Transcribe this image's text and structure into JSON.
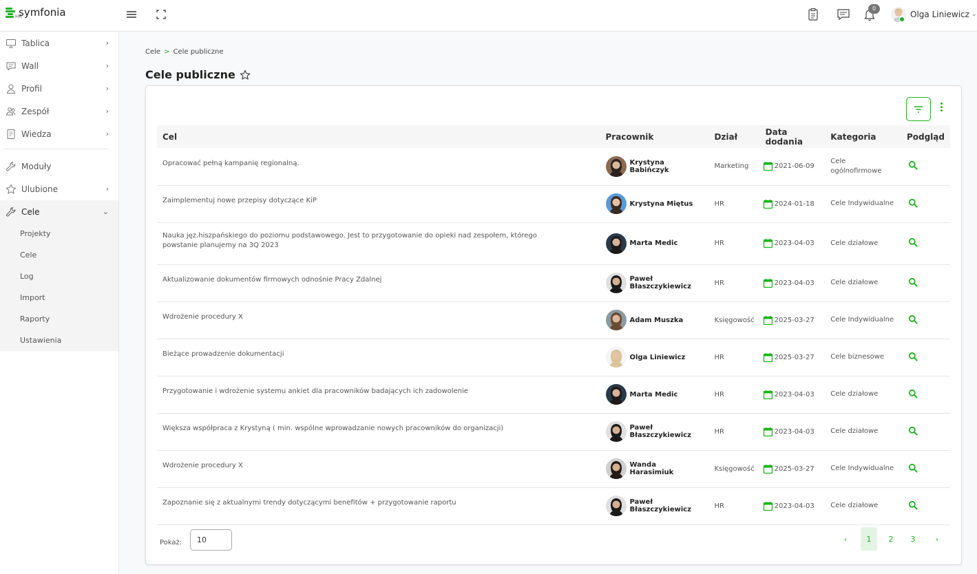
{
  "app": {
    "logo_text": "symfonia",
    "logo_sub": "HR",
    "brand_color": "#1db31d",
    "notification_count": "0",
    "user_name": "Olga Liniewicz"
  },
  "sidebar": {
    "items": [
      {
        "label": "Tablica",
        "icon": "monitor-icon",
        "has_chevron": true
      },
      {
        "label": "Wall",
        "icon": "chat-icon",
        "has_chevron": true
      },
      {
        "label": "Profil",
        "icon": "user-icon",
        "has_chevron": true
      },
      {
        "label": "Zespół",
        "icon": "team-icon",
        "has_chevron": true
      },
      {
        "label": "Wiedza",
        "icon": "book-icon",
        "has_chevron": true
      },
      {
        "label": "Moduły",
        "icon": "wrench-icon",
        "has_chevron": false
      },
      {
        "label": "Ulubione",
        "icon": "star-icon",
        "has_chevron": true
      },
      {
        "label": "Cele",
        "icon": "wrench-icon",
        "has_chevron": true,
        "expanded": true
      }
    ],
    "sub_items": [
      "Projekty",
      "Cele",
      "Log",
      "Import",
      "Raporty",
      "Ustawienia"
    ]
  },
  "breadcrumb": {
    "root": "Cele",
    "separator": ">",
    "current": "Cele publiczne"
  },
  "page_title": "Cele publiczne",
  "table": {
    "columns": [
      "Cel",
      "Pracownik",
      "Dział",
      "Data dodania",
      "Kategoria",
      "Podgląd"
    ],
    "rows": [
      {
        "cel": "Opracować pełną kampanię regionalną.",
        "employee": "Krystyna Babińczyk",
        "dzial": "Marketing",
        "date": "2021-06-09",
        "kategoria": "Cele ogólnofirmowe"
      },
      {
        "cel": "Zaimplementuj nowe przepisy dotyczące KiP",
        "employee": "Krystyna Miętus",
        "dzial": "HR",
        "date": "2024-01-18",
        "kategoria": "Cele Indywidualne"
      },
      {
        "cel": "Nauka jęz.hiszpańskiego do poziomu podstawowego. Jest to przygotowanie do opieki nad zespołem, którego powstanie planujemy na 3Q 2023",
        "employee": "Marta Medic",
        "dzial": "HR",
        "date": "2023-04-03",
        "kategoria": "Cele działowe"
      },
      {
        "cel": "Aktualizowanie dokumentów firmowych odnośnie Pracy Zdalnej",
        "employee": "Paweł Błaszczykiewicz",
        "dzial": "HR",
        "date": "2023-04-03",
        "kategoria": "Cele działowe"
      },
      {
        "cel": "Wdrożenie procedury X",
        "employee": "Adam Muszka",
        "dzial": "Księgowość",
        "date": "2025-03-27",
        "kategoria": "Cele Indywidualne"
      },
      {
        "cel": "Bieżące prowadzenie dokumentacji",
        "employee": "Olga Liniewicz",
        "dzial": "HR",
        "date": "2025-03-27",
        "kategoria": "Cele biznesowe"
      },
      {
        "cel": "Przygotowanie i wdrożenie systemu ankiet dla pracowników badających ich zadowolenie",
        "employee": "Marta Medic",
        "dzial": "HR",
        "date": "2023-04-03",
        "kategoria": "Cele działowe"
      },
      {
        "cel": "Większa współpraca z Krystyną ( min. wspólne wprowadzanie nowych pracowników do organizacji)",
        "employee": "Paweł Błaszczykiewicz",
        "dzial": "HR",
        "date": "2023-04-03",
        "kategoria": "Cele działowe"
      },
      {
        "cel": "Wdrożenie procedury X",
        "employee": "Wanda Harasimiuk",
        "dzial": "Księgowość",
        "date": "2025-03-27",
        "kategoria": "Cele Indywidualne"
      },
      {
        "cel": "Zapoznanie się z aktualnymi trendy dotyczącymi benefitów + przygotowanie raportu",
        "employee": "Paweł Błaszczykiewicz",
        "dzial": "HR",
        "date": "2023-04-03",
        "kategoria": "Cele działowe"
      }
    ]
  },
  "footer": {
    "pokaz_label": "Pokaż:",
    "page_size": "10",
    "prev": "‹",
    "next": "›",
    "pages": [
      "1",
      "2",
      "3"
    ],
    "active_page": "1"
  }
}
